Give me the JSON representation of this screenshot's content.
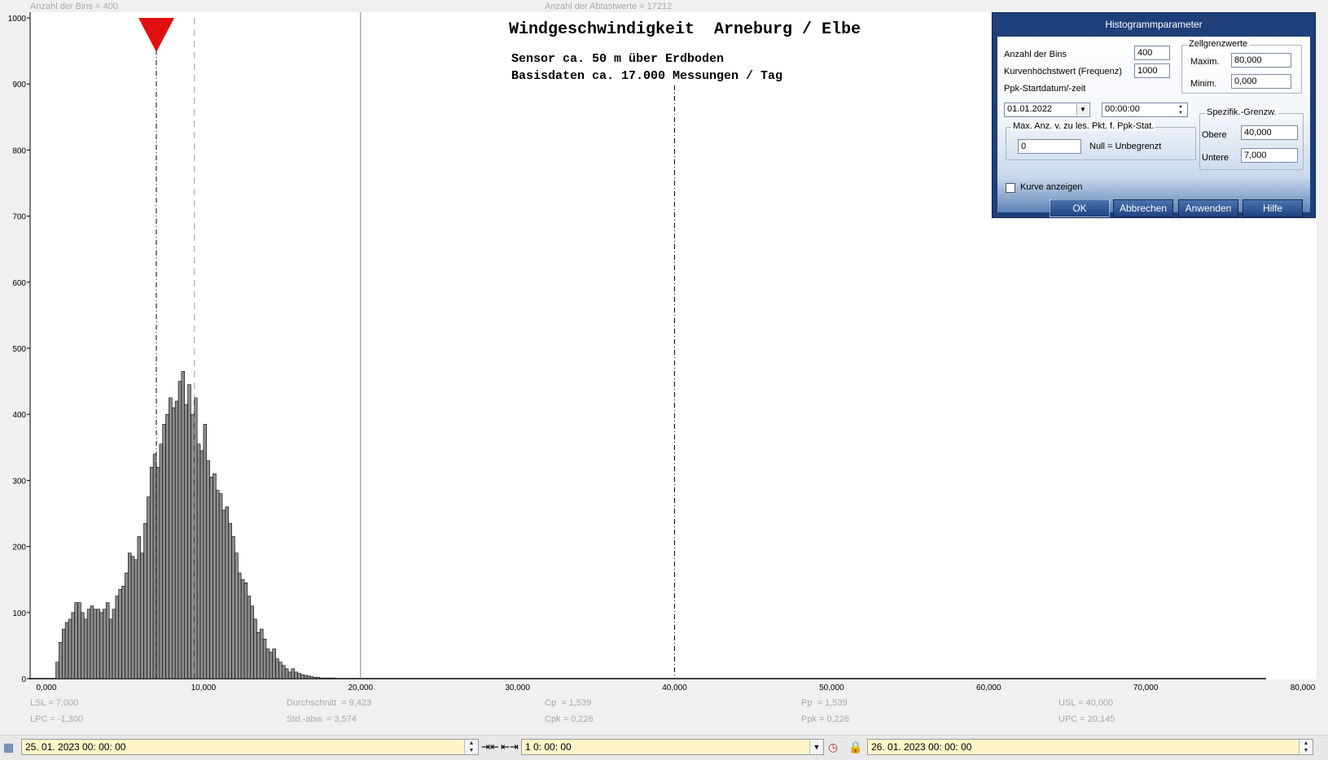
{
  "topbar": {
    "bins_info": "Anzahl der Bins =   400",
    "samples_info": "Anzahl der Abtastwerte = 17212"
  },
  "chart_data": {
    "type": "bar",
    "title": "Windgeschwindigkeit  Arneburg / Elbe",
    "subtitle_lines": [
      "Sensor ca. 50 m über Erdboden",
      "Basisdaten ca. 17.000 Messungen / Tag"
    ],
    "xlabel": "",
    "ylabel": "",
    "xlim": [
      0,
      80
    ],
    "ylim": [
      0,
      1000
    ],
    "x_ticks": [
      "0,000",
      "10,000",
      "20,000",
      "30,000",
      "40,000",
      "50,000",
      "60,000",
      "70,000",
      "80,000"
    ],
    "y_ticks": [
      "0",
      "100",
      "200",
      "300",
      "400",
      "500",
      "600",
      "700",
      "800",
      "900",
      "1000"
    ],
    "bin_width": 0.2,
    "x_start": 0.6,
    "values": [
      25,
      55,
      75,
      85,
      90,
      100,
      115,
      115,
      100,
      90,
      105,
      110,
      105,
      105,
      100,
      105,
      115,
      90,
      105,
      125,
      135,
      140,
      160,
      190,
      185,
      180,
      215,
      190,
      235,
      275,
      320,
      340,
      320,
      355,
      385,
      400,
      425,
      410,
      420,
      450,
      465,
      415,
      445,
      400,
      425,
      355,
      345,
      385,
      330,
      305,
      310,
      285,
      280,
      255,
      260,
      235,
      215,
      190,
      160,
      150,
      145,
      125,
      110,
      90,
      70,
      75,
      60,
      45,
      40,
      45,
      30,
      25,
      20,
      15,
      10,
      15,
      10,
      8,
      6,
      5,
      4,
      3,
      2,
      2,
      1,
      1,
      1,
      1,
      1
    ],
    "markers": {
      "lsl": 7.0,
      "mean": 9.423,
      "line_20": 20.0,
      "usl": 40.0
    },
    "colors": {
      "bar_fill": "#8c8c8c",
      "bar_edge": "#000000",
      "marker": "#e01010"
    }
  },
  "stats": {
    "lsl": "LSL = 7,000",
    "lpc": "LPC = -1,300",
    "mean": "Durchschnitt  = 9,423",
    "std": "Std.-abw. = 3,574",
    "cp": "Cp  = 1,539",
    "cpk": "Cpk = 0,226",
    "pp": "Pp  = 1,539",
    "ppk": "Ppk = 0,226",
    "usl": "USL = 40,000",
    "upc": "UPC = 20,145"
  },
  "dialog": {
    "title": "Histogrammparameter",
    "bins_label": "Anzahl der Bins",
    "bins_value": "400",
    "curve_max_label": "Kurvenhöchstwert (Frequenz)",
    "curve_max_value": "1000",
    "start_label": "Ppk-Startdatum/-zeit",
    "start_date": "01.01.2022",
    "start_time": "00:00:00",
    "cell_group": "Zellgrenzwerte",
    "max_label": "Maxim.",
    "max_value": "80,000",
    "min_label": "Minim.",
    "min_value": "0,000",
    "spec_group": "Spezifik.-Grenzw.",
    "upper_label": "Obere",
    "upper_value": "40,000",
    "lower_label": "Untere",
    "lower_value": "7,000",
    "maxpts_group": "Max. Anz. v. zu les. Pkt. f. Ppk-Stat.",
    "maxpts_value": "0",
    "null_label": "Null = Unbegrenzt",
    "curve_checkbox": "Kurve anzeigen",
    "ok": "OK",
    "cancel": "Abbrechen",
    "apply": "Anwenden",
    "help": "Hilfe"
  },
  "bottombar": {
    "start": "25. 01.  2023    00: 00: 00",
    "interval": "1  0: 00: 00",
    "end": "26. 01.  2023    00: 00: 00"
  }
}
